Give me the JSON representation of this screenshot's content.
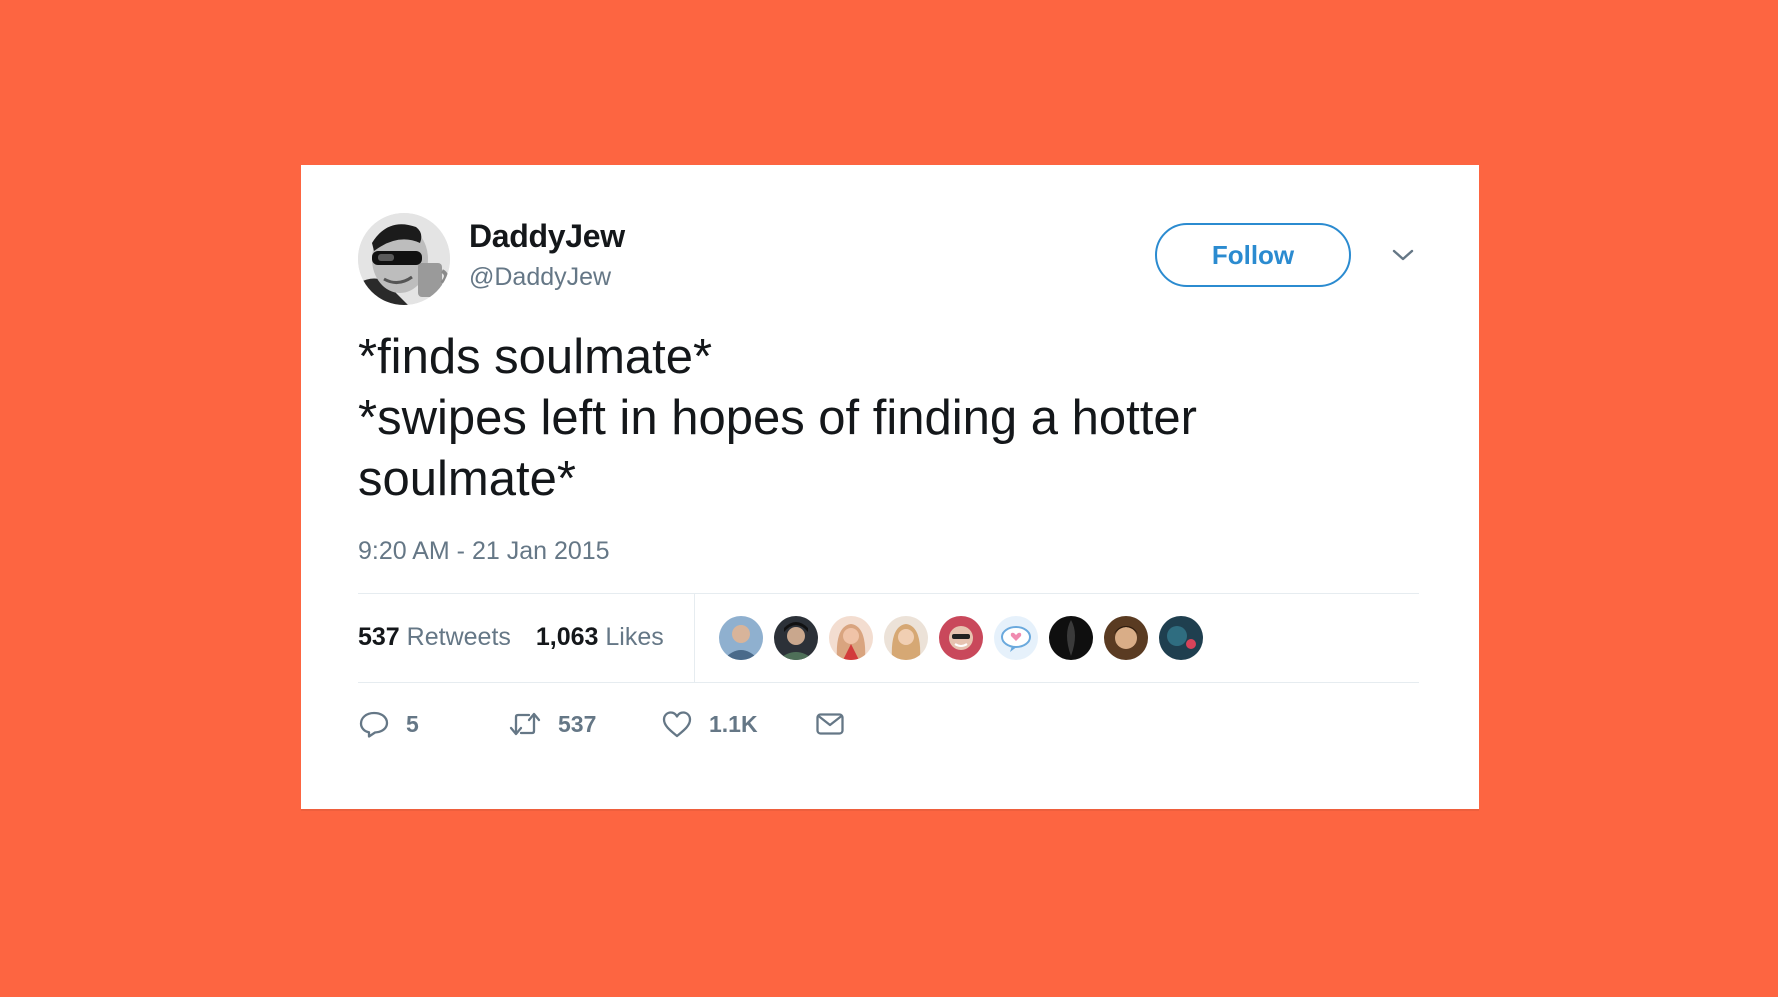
{
  "colors": {
    "background": "#fd6541",
    "card": "#ffffff",
    "accent": "#2b8bd0",
    "text_primary": "#14171a",
    "text_secondary": "#657786"
  },
  "tweet": {
    "author": {
      "display_name": "DaddyJew",
      "handle": "@DaddyJew",
      "avatar_icon": "profile-photo"
    },
    "follow_label": "Follow",
    "menu_icon": "chevron-down-icon",
    "text_lines": [
      "*finds soulmate*",
      "*swipes left in hopes of finding a hotter",
      "soulmate*"
    ],
    "timestamp": "9:20 AM - 21 Jan 2015",
    "stats": {
      "retweets_count": "537",
      "retweets_label": "Retweets",
      "likes_count": "1,063",
      "likes_label": "Likes"
    },
    "likers": [
      {
        "icon": "liker-avatar-1",
        "color": "#5b7fa6"
      },
      {
        "icon": "liker-avatar-2",
        "color": "#2c3138"
      },
      {
        "icon": "liker-avatar-3",
        "color": "#e8b89c"
      },
      {
        "icon": "liker-avatar-4",
        "color": "#d9b08c"
      },
      {
        "icon": "liker-avatar-5",
        "color": "#c9485b"
      },
      {
        "icon": "liker-avatar-6",
        "color": "#cfe3f5"
      },
      {
        "icon": "liker-avatar-7",
        "color": "#111111"
      },
      {
        "icon": "liker-avatar-8",
        "color": "#5a3b22"
      },
      {
        "icon": "liker-avatar-9",
        "color": "#1f3f4f"
      }
    ],
    "actions": {
      "reply": {
        "icon": "reply-icon",
        "count": "5"
      },
      "retweet": {
        "icon": "retweet-icon",
        "count": "537"
      },
      "like": {
        "icon": "heart-icon",
        "count": "1.1K"
      },
      "message": {
        "icon": "envelope-icon"
      }
    }
  }
}
